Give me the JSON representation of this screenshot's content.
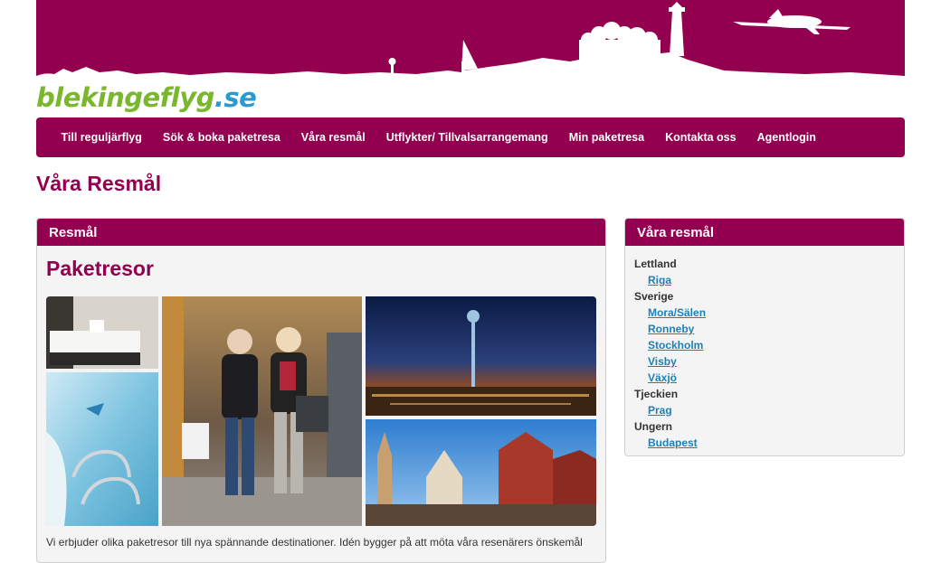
{
  "colors": {
    "brand": "#930050",
    "logo_green": "#79b82c",
    "logo_blue": "#2a9ad0",
    "link": "#1f7fb7"
  },
  "logo": {
    "part1": "blekingeflyg",
    "part2": ".se"
  },
  "nav": {
    "items": [
      {
        "label": "Till reguljärflyg"
      },
      {
        "label": "Sök & boka paketresa"
      },
      {
        "label": "Våra resmål"
      },
      {
        "label": "Utflykter/ Tillvalsarrangemang"
      },
      {
        "label": "Min paketresa"
      },
      {
        "label": "Kontakta oss"
      },
      {
        "label": "Agentlogin"
      }
    ]
  },
  "page": {
    "title": "Våra Resmål"
  },
  "main_panel": {
    "header": "Resmål",
    "heading": "Paketresor",
    "intro": "Vi erbjuder olika paketresor till nya spännande destinationer. Idén bygger på att möta våra resenärers önskemål",
    "images": [
      "hotel-room-photo",
      "pool-photo",
      "shopping-women-photo",
      "berlin-night-photo",
      "riga-old-town-photo"
    ]
  },
  "sidebar": {
    "header": "Våra resmål",
    "countries": [
      {
        "name": "Lettland",
        "cities": [
          "Riga"
        ]
      },
      {
        "name": "Sverige",
        "cities": [
          "Mora/Sälen",
          "Ronneby",
          "Stockholm",
          "Visby",
          "Växjö"
        ]
      },
      {
        "name": "Tjeckien",
        "cities": [
          "Prag"
        ]
      },
      {
        "name": "Ungern",
        "cities": [
          "Budapest"
        ]
      }
    ]
  }
}
